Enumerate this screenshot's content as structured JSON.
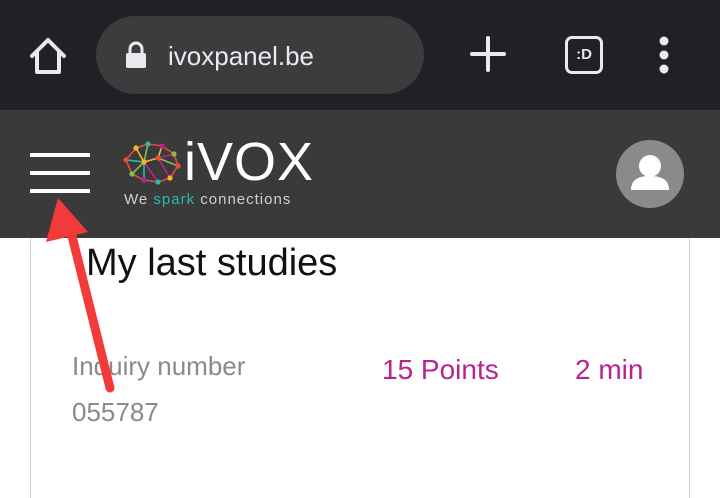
{
  "browser": {
    "url": "ivoxpanel.be",
    "tabs_label": ":D",
    "icons": [
      "home-icon",
      "lock-icon",
      "plus-icon",
      "tabs-icon",
      "more-vert-icon"
    ]
  },
  "header": {
    "logo_text": "iVOX",
    "tagline_pre": "We ",
    "tagline_accent": "spark",
    "tagline_post": " connections",
    "icons": [
      "menu-icon",
      "avatar-icon"
    ]
  },
  "main": {
    "section_title": "My last studies",
    "study": {
      "inquiry_label": "Inquiry number",
      "inquiry_number": "055787",
      "points": "15 Points",
      "duration": "2 min"
    }
  },
  "colors": {
    "browser_bg": "#202124",
    "url_pill": "#3c3c3f",
    "header_bg": "#3a3a3a",
    "accent_magenta": "#b8238f",
    "tagline_teal": "#28b9b0",
    "annotation_red": "#f23a3a"
  }
}
